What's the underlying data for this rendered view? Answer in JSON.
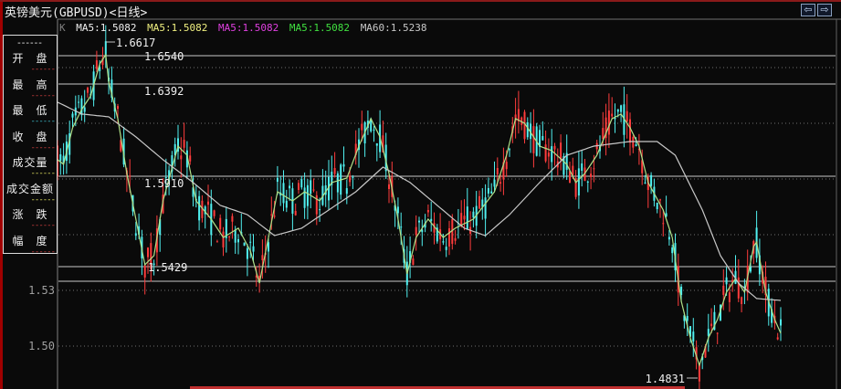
{
  "title": "英镑美元(GBPUSD)<日线>",
  "nav": {
    "prev": "⇦",
    "next": "⇨"
  },
  "legend": {
    "k": "K",
    "ma1": "MA5:1.5082",
    "ma2": "MA5:1.5082",
    "ma3": "MA5:1.5082",
    "ma4": "MA5:1.5082",
    "ma60": "MA60:1.5238"
  },
  "info": {
    "header": "------",
    "rows": [
      {
        "label": "开　盘",
        "value": "------",
        "color": "#d04040"
      },
      {
        "label": "最　高",
        "value": "------",
        "color": "#d04040"
      },
      {
        "label": "最　低",
        "value": "------",
        "color": "#40c0d0"
      },
      {
        "label": "收　盘",
        "value": "------",
        "color": "#d04040"
      },
      {
        "label": "成交量",
        "value": "------",
        "color": "#e0e060"
      },
      {
        "label": "成交金额",
        "value": "------",
        "color": "#e0e060"
      },
      {
        "label": "涨　跌",
        "value": "------",
        "color": "#d04040"
      },
      {
        "label": "幅　度",
        "value": "------",
        "color": "#d04040"
      }
    ]
  },
  "chart_data": {
    "type": "candlestick",
    "ylim": [
      1.475,
      1.67
    ],
    "yticks": [
      "1.53",
      "1.50"
    ],
    "levels": [
      "1.6540",
      "1.6392",
      "1.5910",
      "1.5429",
      "1.5350"
    ],
    "high_label": "1.6617",
    "low_label": "1.4831",
    "days": 241,
    "trend_keypoints": [
      [
        0,
        1.6004
      ],
      [
        2,
        1.5979
      ],
      [
        5,
        1.6176
      ],
      [
        8,
        1.6274
      ],
      [
        11,
        1.6348
      ],
      [
        14,
        1.652
      ],
      [
        16,
        1.6569
      ],
      [
        17,
        1.6422
      ],
      [
        20,
        1.6225
      ],
      [
        23,
        1.593
      ],
      [
        26,
        1.5684
      ],
      [
        29,
        1.5438
      ],
      [
        32,
        1.5487
      ],
      [
        35,
        1.5782
      ],
      [
        40,
        1.6077
      ],
      [
        43,
        1.6028
      ],
      [
        46,
        1.5782
      ],
      [
        51,
        1.5684
      ],
      [
        55,
        1.5585
      ],
      [
        60,
        1.5635
      ],
      [
        64,
        1.5512
      ],
      [
        67,
        1.5339
      ],
      [
        70,
        1.5585
      ],
      [
        73,
        1.5831
      ],
      [
        78,
        1.5782
      ],
      [
        82,
        1.5831
      ],
      [
        87,
        1.5782
      ],
      [
        91,
        1.5881
      ],
      [
        96,
        1.5905
      ],
      [
        100,
        1.6077
      ],
      [
        104,
        1.6225
      ],
      [
        107,
        1.6127
      ],
      [
        110,
        1.593
      ],
      [
        113,
        1.5684
      ],
      [
        116,
        1.5389
      ],
      [
        119,
        1.5585
      ],
      [
        123,
        1.5684
      ],
      [
        128,
        1.5585
      ],
      [
        132,
        1.5635
      ],
      [
        138,
        1.5684
      ],
      [
        145,
        1.5831
      ],
      [
        149,
        1.6028
      ],
      [
        152,
        1.6225
      ],
      [
        155,
        1.62
      ],
      [
        160,
        1.6077
      ],
      [
        164,
        1.6053
      ],
      [
        169,
        1.5979
      ],
      [
        172,
        1.5881
      ],
      [
        175,
        1.593
      ],
      [
        179,
        1.6028
      ],
      [
        184,
        1.6225
      ],
      [
        187,
        1.625
      ],
      [
        190,
        1.6176
      ],
      [
        193,
        1.6077
      ],
      [
        196,
        1.5881
      ],
      [
        201,
        1.5733
      ],
      [
        204,
        1.5585
      ],
      [
        207,
        1.5241
      ],
      [
        210,
        1.5044
      ],
      [
        213,
        1.4897
      ],
      [
        216,
        1.5044
      ],
      [
        219,
        1.5143
      ],
      [
        222,
        1.529
      ],
      [
        225,
        1.5364
      ],
      [
        228,
        1.529
      ],
      [
        231,
        1.5536
      ],
      [
        232,
        1.5561
      ],
      [
        235,
        1.529
      ],
      [
        238,
        1.5143
      ],
      [
        240,
        1.5069
      ]
    ],
    "ma60_keypoints": [
      [
        0,
        1.6314
      ],
      [
        8,
        1.625
      ],
      [
        17,
        1.6235
      ],
      [
        26,
        1.6127
      ],
      [
        35,
        1.6004
      ],
      [
        45,
        1.5881
      ],
      [
        54,
        1.5758
      ],
      [
        63,
        1.5708
      ],
      [
        72,
        1.5595
      ],
      [
        81,
        1.5635
      ],
      [
        90,
        1.5733
      ],
      [
        99,
        1.5831
      ],
      [
        108,
        1.5964
      ],
      [
        117,
        1.5881
      ],
      [
        126,
        1.5758
      ],
      [
        135,
        1.5635
      ],
      [
        142,
        1.5595
      ],
      [
        150,
        1.5708
      ],
      [
        160,
        1.5881
      ],
      [
        169,
        1.6028
      ],
      [
        178,
        1.6077
      ],
      [
        190,
        1.6102
      ],
      [
        199,
        1.6102
      ],
      [
        205,
        1.6028
      ],
      [
        214,
        1.5733
      ],
      [
        220,
        1.5487
      ],
      [
        226,
        1.5339
      ],
      [
        232,
        1.5256
      ],
      [
        240,
        1.5246
      ]
    ],
    "colors": {
      "up": "#ff3c3c",
      "down": "#50f0f0",
      "ma5": "#b0e088",
      "ma60": "#c8c8c8"
    }
  }
}
